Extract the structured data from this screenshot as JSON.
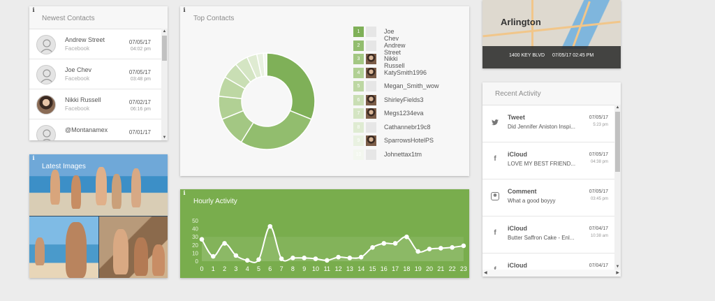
{
  "info_glyph": "i",
  "newest_contacts": {
    "title": "Newest Contacts",
    "items": [
      {
        "name": "Andrew Street",
        "source": "Facebook",
        "date": "07/05/17",
        "time": "04:02 pm",
        "avatar": "default-avatar"
      },
      {
        "name": "Joe Chev",
        "source": "Facebook",
        "date": "07/05/17",
        "time": "03:48 pm",
        "avatar": "default-avatar"
      },
      {
        "name": "Nikki Russell",
        "source": "Facebook",
        "date": "07/02/17",
        "time": "06:16 pm",
        "avatar": "photo-avatar"
      },
      {
        "name": "@Montanamex",
        "source": "",
        "date": "07/01/17",
        "time": "",
        "avatar": "default-avatar"
      }
    ]
  },
  "latest_images": {
    "title": "Latest Images"
  },
  "top_contacts": {
    "title": "Top Contacts",
    "chart_data": {
      "type": "pie",
      "categories": [
        "Joe Chev",
        "Andrew Street",
        "Nikki Russell",
        "KatySmith1996",
        "Megan_Smith_wow",
        "ShirleyFields3",
        "Megs1234eva",
        "Cathannebr19c8",
        "SparrowsHotelPS",
        "Johnettax1tm"
      ],
      "values": [
        28,
        25,
        9,
        7,
        6,
        5,
        4,
        3,
        2,
        1
      ],
      "colors": [
        "#7fb058",
        "#92bd6e",
        "#a3c783",
        "#b1d094",
        "#bdd7a3",
        "#c9deb4",
        "#d4e5c3",
        "#dfebd2",
        "#e9f1e1",
        "#f3f7ef"
      ]
    },
    "legend": [
      {
        "rank": "1",
        "name": "Joe Chev",
        "avatar": "default-avatar"
      },
      {
        "rank": "2",
        "name": "Andrew Street",
        "avatar": "default-avatar"
      },
      {
        "rank": "3",
        "name": "Nikki Russell",
        "avatar": "photo-avatar"
      },
      {
        "rank": "4",
        "name": "KatySmith1996",
        "avatar": "photo-avatar"
      },
      {
        "rank": "5",
        "name": "Megan_Smith_wow",
        "avatar": "default-avatar"
      },
      {
        "rank": "6",
        "name": "ShirleyFields3",
        "avatar": "photo-avatar"
      },
      {
        "rank": "7",
        "name": "Megs1234eva",
        "avatar": "photo-avatar"
      },
      {
        "rank": "8",
        "name": "Cathannebr19c8",
        "avatar": "default-avatar"
      },
      {
        "rank": "9",
        "name": "SparrowsHotelPS",
        "avatar": "photo-avatar"
      },
      {
        "rank": "10",
        "name": "Johnettax1tm",
        "avatar": "default-avatar"
      }
    ]
  },
  "hourly_activity": {
    "title": "Hourly Activity",
    "chart_data": {
      "type": "area",
      "x": [
        0,
        1,
        2,
        3,
        4,
        5,
        6,
        7,
        8,
        9,
        10,
        11,
        12,
        13,
        14,
        15,
        16,
        17,
        18,
        19,
        20,
        21,
        22,
        23
      ],
      "y": [
        27,
        6,
        22,
        7,
        1,
        2,
        43,
        3,
        4,
        4,
        3,
        1,
        5,
        4,
        5,
        17,
        22,
        22,
        30,
        12,
        15,
        16,
        17,
        19
      ],
      "yticks": [
        0,
        10,
        20,
        30,
        40,
        50
      ],
      "ylim": [
        0,
        50
      ],
      "grid": false
    }
  },
  "map": {
    "city": "Arlington",
    "address": "1400 KEY BLVD",
    "timestamp": "07/05/17 02:45 PM"
  },
  "recent_activity": {
    "title": "Recent Activity",
    "items": [
      {
        "type": "Tweet",
        "icon": "twitter-icon",
        "glyph": "🐦",
        "text": "Did Jennifer Aniston Inspi...",
        "date": "07/05/17",
        "time": "5:23 pm"
      },
      {
        "type": "iCloud",
        "icon": "facebook-icon",
        "glyph": "f",
        "text": "LOVE MY BEST FRIEND...",
        "date": "07/05/17",
        "time": "04:38 pm"
      },
      {
        "type": "Comment",
        "icon": "instagram-icon",
        "glyph": "◉",
        "text": "What a good boyyy",
        "date": "07/05/17",
        "time": "03:45 pm"
      },
      {
        "type": "iCloud",
        "icon": "facebook-icon",
        "glyph": "f",
        "text": "Butter Saffron Cake - Enl...",
        "date": "07/04/17",
        "time": "10:38 am"
      },
      {
        "type": "iCloud",
        "icon": "facebook-icon",
        "glyph": "f",
        "text": "",
        "date": "07/04/17",
        "time": ""
      }
    ]
  },
  "scroll_arrows": {
    "up": "▲",
    "down": "▼",
    "left": "◀",
    "right": "▶"
  }
}
